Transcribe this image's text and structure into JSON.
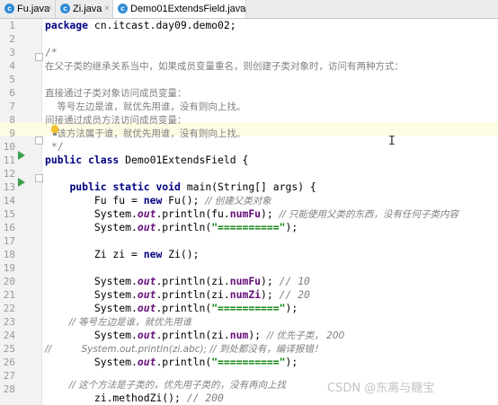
{
  "tabs": [
    {
      "label": "Fu.java",
      "icon": "c"
    },
    {
      "label": "Zi.java",
      "icon": "c"
    },
    {
      "label": "Demo01ExtendsField.java",
      "icon": "c"
    }
  ],
  "line_numbers": [
    "1",
    "2",
    "3",
    "4",
    "5",
    "6",
    "7",
    "8",
    "9",
    "10",
    "11",
    "12",
    "13",
    "14",
    "15",
    "16",
    "17",
    "18",
    "19",
    "20",
    "21",
    "22",
    "23",
    "24",
    "25",
    "26",
    "27",
    "28"
  ],
  "code": {
    "l1_kw": "package",
    "l1_rest": " cn.itcast.day09.demo02;",
    "l3": "/*",
    "l4": "在父子类的继承关系当中，如果成员变量重名，则创建子类对象时，访问有两种方式：",
    "l6": "直接通过子类对象访问成员变量：",
    "l7": "    等号左边是谁，就优先用谁，没有则向上找。",
    "l8": "间接通过成员方法访问成员变量：",
    "l9": "    该方法属于谁，就优先用谁，没有则向上找。",
    "l10": " */",
    "l11_kw": "public class",
    "l11_rest": " Demo01ExtendsField {",
    "l13_indent": "    ",
    "l13_kw": "public static void",
    "l13_rest": " main(String[] args) {",
    "l14_a": "        Fu fu = ",
    "l14_kw": "new",
    "l14_b": " Fu(); ",
    "l14_cm": "// 创建父类对象",
    "l15_a": "        System.",
    "l15_out": "out",
    "l15_b": ".println(fu.",
    "l15_fld": "numFu",
    "l15_c": "); ",
    "l15_cm": "// 只能使用父类的东西，没有任何子类内容",
    "l16_a": "        System.",
    "l16_out": "out",
    "l16_b": ".println(",
    "l16_str": "\"==========\"",
    "l16_c": ");",
    "l18_a": "        Zi zi = ",
    "l18_kw": "new",
    "l18_b": " Zi();",
    "l20_a": "        System.",
    "l20_out": "out",
    "l20_b": ".println(zi.",
    "l20_fld": "numFu",
    "l20_c": "); ",
    "l20_cm": "// 10",
    "l21_a": "        System.",
    "l21_out": "out",
    "l21_b": ".println(zi.",
    "l21_fld": "numZi",
    "l21_c": "); ",
    "l21_cm": "// 20",
    "l22_a": "        System.",
    "l22_out": "out",
    "l22_b": ".println(",
    "l22_str": "\"==========\"",
    "l22_c": ");",
    "l24_cm": "        // 等号左边是谁，就优先用谁",
    "l25_a": "        System.",
    "l25_out": "out",
    "l25_b": ".println(zi.",
    "l25_fld": "num",
    "l25_c": "); ",
    "l25_cm": "// 优先子类， 200",
    "l26_cm": "//          System.out.println(zi.abc); // 到处都没有，编译报错！",
    "l27_a": "        System.",
    "l27_out": "out",
    "l27_b": ".println(",
    "l27_str": "\"==========\"",
    "l27_c": ");",
    "l29_cm": "        // 这个方法是子类的，优先用子类的，没有再向上找",
    "l30_a": "        zi.methodZi(); ",
    "l30_cm": "// 200"
  },
  "watermark": "CSDN @东离与糖宝",
  "colors": {
    "keyword": "#000080",
    "comment": "#808080",
    "string": "#008000",
    "field": "#660e7a",
    "run_icon": "#3aa04a",
    "active_tab_icon": "#2f8ad6"
  }
}
